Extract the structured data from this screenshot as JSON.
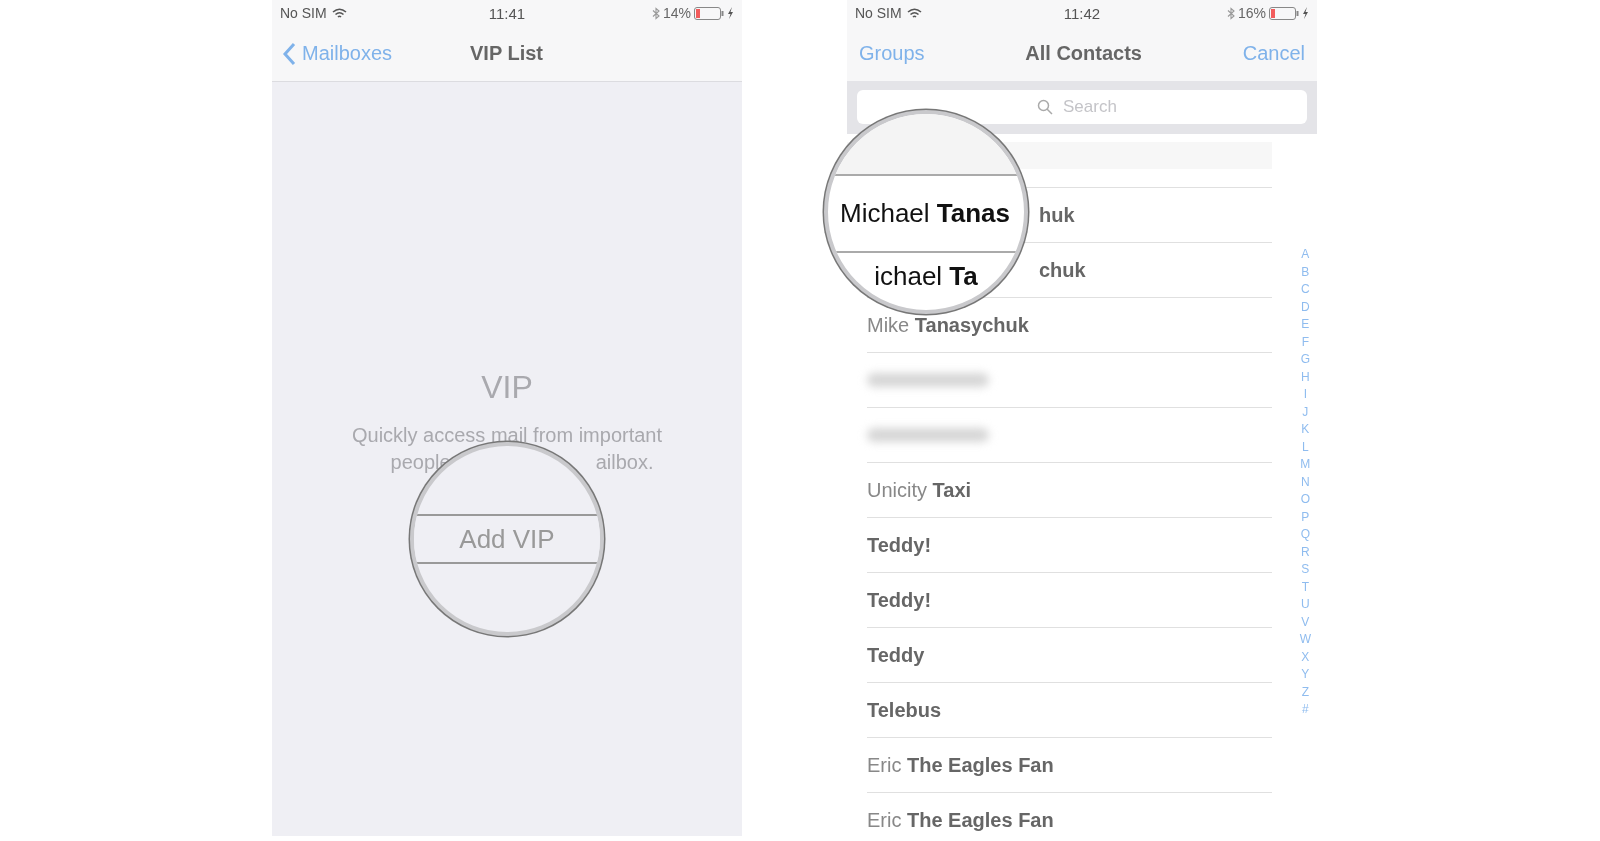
{
  "left_phone": {
    "status_bar": {
      "carrier": "No SIM",
      "time": "11:41",
      "battery": "14%"
    },
    "nav": {
      "back": "Mailboxes",
      "title": "VIP List"
    },
    "empty_state": {
      "title": "VIP",
      "line_1": "Quickly access mail from important",
      "line_2_start": "people",
      "line_2_end": "ailbox."
    },
    "magnifier": {
      "button": "Add VIP"
    }
  },
  "right_phone": {
    "status_bar": {
      "carrier": "No SIM",
      "time": "11:42",
      "battery": "16%"
    },
    "nav": {
      "left": "Groups",
      "title": "All Contacts",
      "right": "Cancel"
    },
    "search": {
      "placeholder": "Search"
    },
    "contacts": [
      {
        "kind": "partial",
        "last": "huk"
      },
      {
        "kind": "partial",
        "last": "chuk"
      },
      {
        "kind": "name",
        "first": "Mike",
        "last": "Tanasychuk"
      },
      {
        "kind": "blurred"
      },
      {
        "kind": "blurred"
      },
      {
        "kind": "name",
        "first": "Unicity",
        "last": "Taxi"
      },
      {
        "kind": "name",
        "last": "Teddy!"
      },
      {
        "kind": "name",
        "last": "Teddy!"
      },
      {
        "kind": "name",
        "last": "Teddy"
      },
      {
        "kind": "name",
        "last": "Telebus"
      },
      {
        "kind": "name",
        "first": "Eric",
        "last": "The Eagles Fan"
      },
      {
        "kind": "name",
        "first": "Eric",
        "last": "The Eagles Fan"
      }
    ],
    "index": [
      "A",
      "B",
      "C",
      "D",
      "E",
      "F",
      "G",
      "H",
      "I",
      "J",
      "K",
      "L",
      "M",
      "N",
      "O",
      "P",
      "Q",
      "R",
      "S",
      "T",
      "U",
      "V",
      "W",
      "X",
      "Y",
      "Z",
      "#"
    ],
    "magnifier": {
      "rows": [
        {
          "first": "Michael",
          "last": "Tanas"
        },
        {
          "first": "ichael",
          "last": "Ta"
        }
      ]
    }
  }
}
